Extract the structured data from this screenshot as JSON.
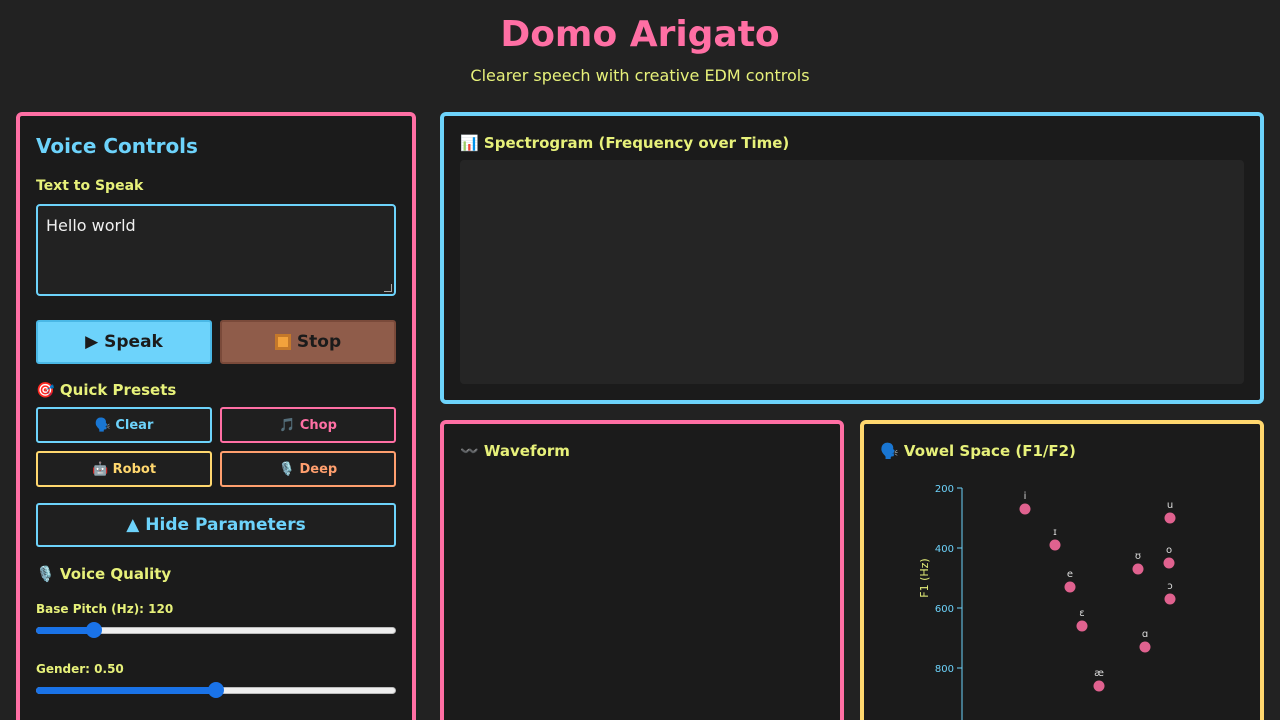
{
  "header": {
    "title": "Domo Arigato",
    "subtitle": "Clearer speech with creative EDM controls"
  },
  "controls": {
    "title": "Voice Controls",
    "text_label": "Text to Speak",
    "text_value": "Hello world",
    "speak_label": "▶ Speak",
    "stop_label": "Stop",
    "presets_title": "🎯 Quick Presets",
    "presets": [
      {
        "label": "🗣️ Clear"
      },
      {
        "label": "🎵 Chop"
      },
      {
        "label": "🤖 Robot"
      },
      {
        "label": "🎙️ Deep"
      }
    ],
    "hide_label": "▲ Hide Parameters",
    "voice_quality_title": "🎙️ Voice Quality",
    "base_pitch_label": "Base Pitch (Hz): 120",
    "base_pitch_fraction": 0.16,
    "gender_label": "Gender: 0.50",
    "gender_fraction": 0.5
  },
  "spectrogram": {
    "title": "📊 Spectrogram (Frequency over Time)"
  },
  "waveform": {
    "title": "〰️ Waveform"
  },
  "vowel_space": {
    "title": "🗣️ Vowel Space (F1/F2)",
    "y_axis_label": "F1 (Hz)",
    "y_ticks": [
      "200",
      "400",
      "600",
      "800"
    ],
    "colors": {
      "axis": "#6dd3fb",
      "point": "#e0628f",
      "label": "#e7f17a"
    }
  },
  "chart_data": {
    "type": "scatter",
    "title": "",
    "ylabel": "F1 (Hz)",
    "ylim": [
      200,
      900
    ],
    "y_ticks": [
      200,
      400,
      600,
      800
    ],
    "points": [
      {
        "vowel": "i",
        "f1": 270,
        "f2": 2290
      },
      {
        "vowel": "ɪ",
        "f1": 390,
        "f2": 1990
      },
      {
        "vowel": "e",
        "f1": 530,
        "f2": 1840
      },
      {
        "vowel": "ɛ",
        "f1": 660,
        "f2": 1720
      },
      {
        "vowel": "æ",
        "f1": 860,
        "f2": 1550
      },
      {
        "vowel": "ɑ",
        "f1": 730,
        "f2": 1090
      },
      {
        "vowel": "ɔ",
        "f1": 570,
        "f2": 840
      },
      {
        "vowel": "o",
        "f1": 450,
        "f2": 850
      },
      {
        "vowel": "ʊ",
        "f1": 470,
        "f2": 1160
      },
      {
        "vowel": "u",
        "f1": 300,
        "f2": 840
      }
    ]
  }
}
